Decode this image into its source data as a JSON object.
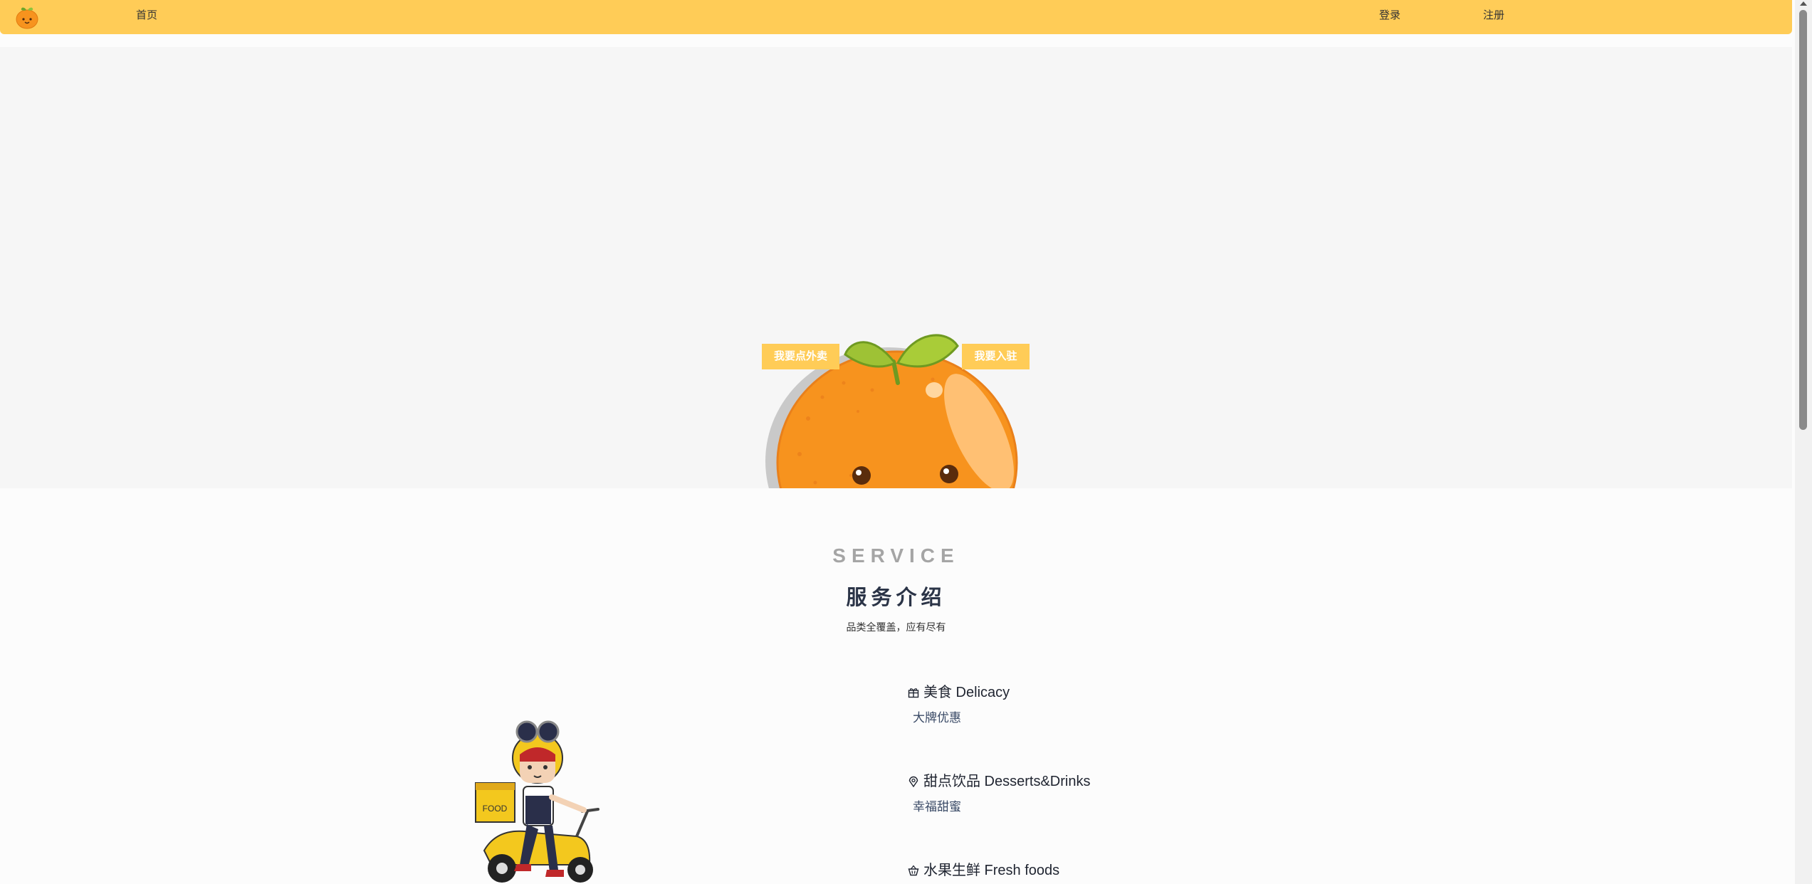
{
  "nav": {
    "logo_icon": "orange-logo-icon",
    "home": "首页",
    "login": "登录",
    "register": "注册",
    "bar_color": "#ffcc57"
  },
  "hero": {
    "mascot_icon": "orange-mascot-illustration",
    "order_button": "我要点外卖",
    "join_button": "我要入驻"
  },
  "service": {
    "title_en": "SERVICE",
    "title_cn": "服务介绍",
    "subtitle": "品类全覆盖，应有尽有",
    "rider_icon": "delivery-rider-illustration",
    "rider_box_label": "FOOD",
    "features": [
      {
        "icon": "gift-box-icon",
        "title": "美食 Delicacy",
        "desc": "大牌优惠"
      },
      {
        "icon": "location-pin-icon",
        "title": "甜点饮品 Desserts&Drinks",
        "desc": "幸福甜蜜"
      },
      {
        "icon": "basket-icon",
        "title": "水果生鲜 Fresh foods",
        "desc": ""
      }
    ]
  }
}
